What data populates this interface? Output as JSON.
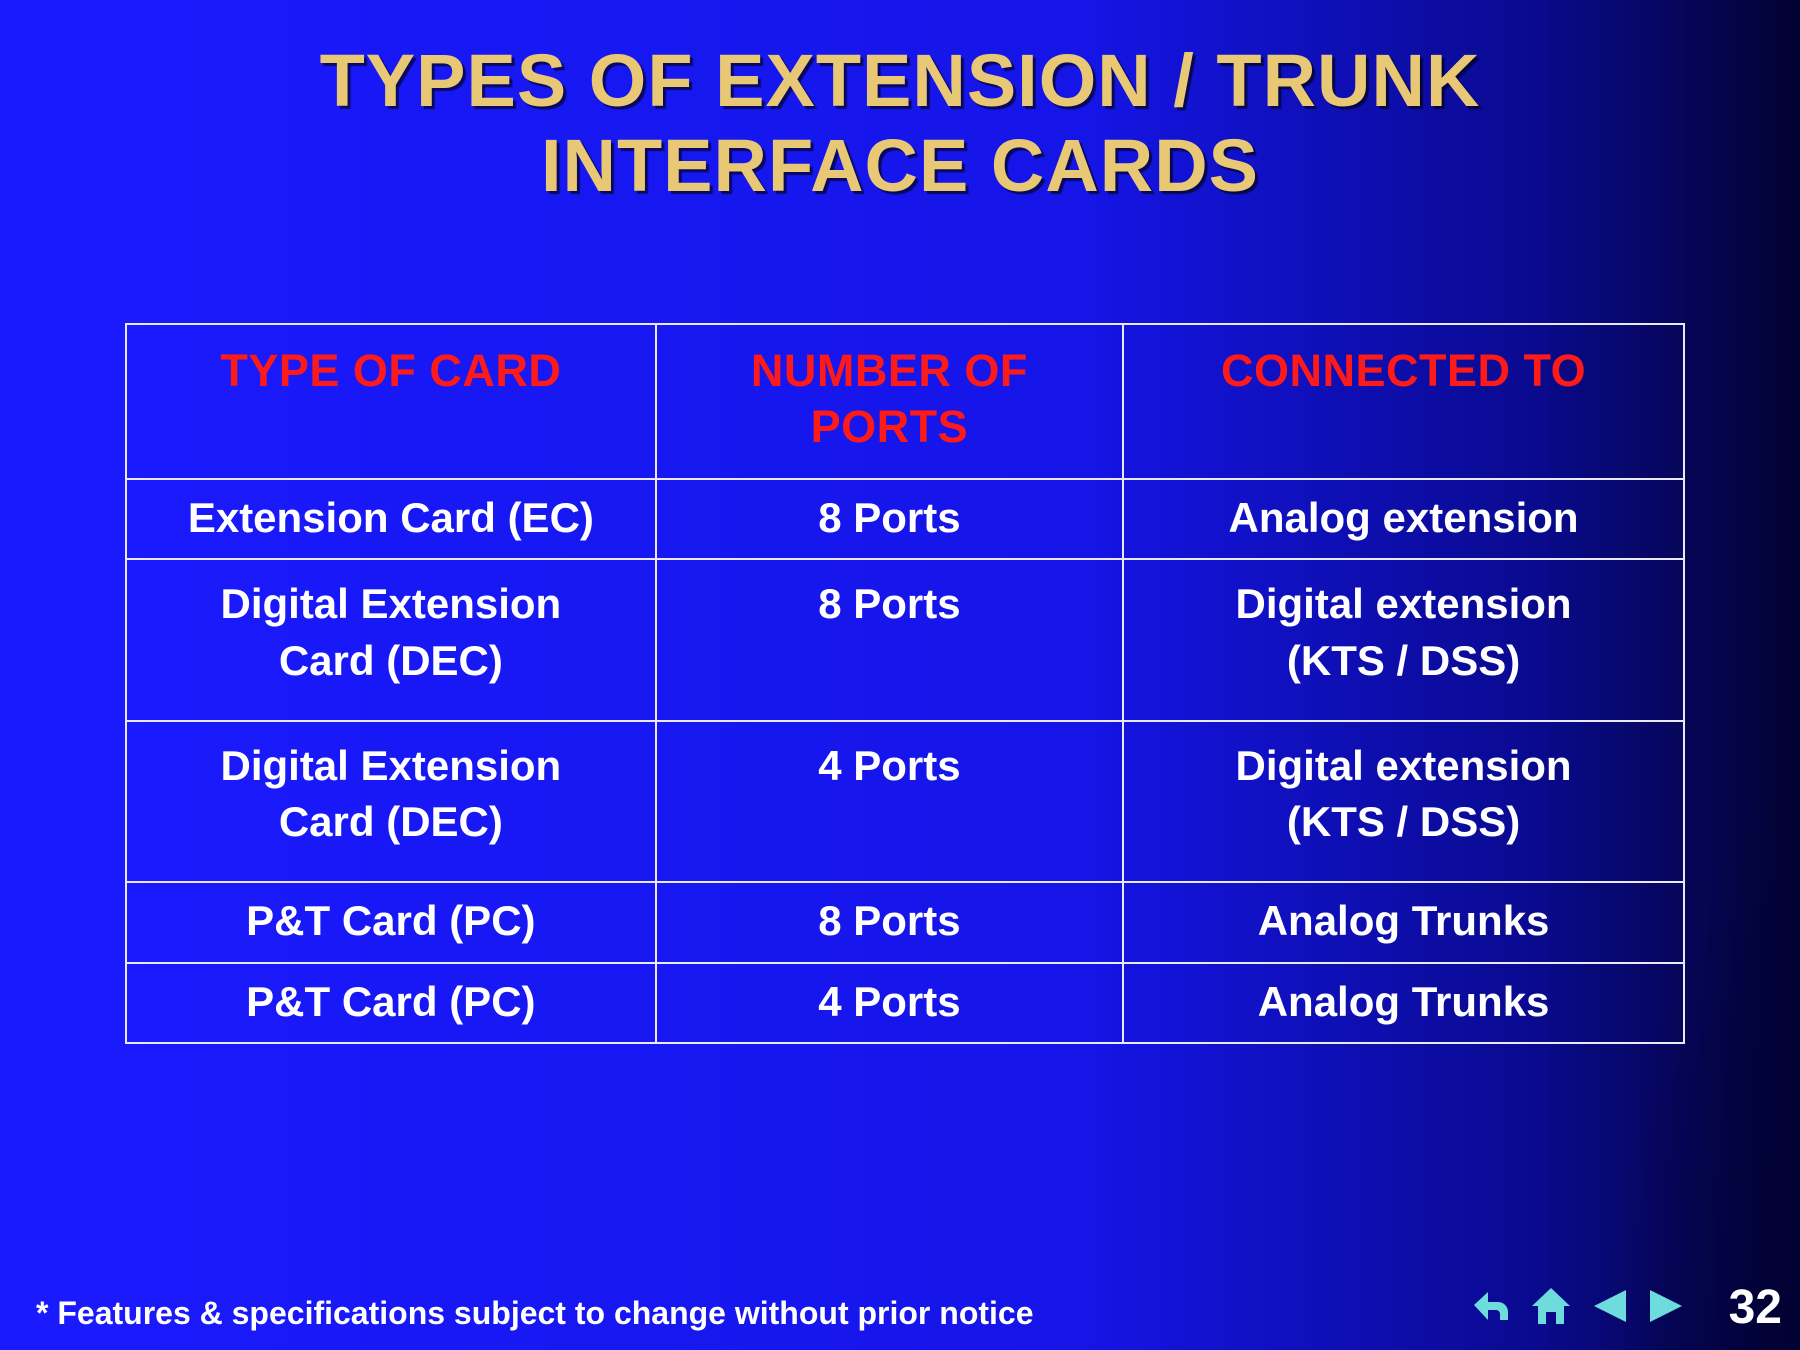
{
  "title": "TYPES OF EXTENSION / TRUNK\nINTERFACE CARDS",
  "table": {
    "headers": [
      "TYPE OF CARD",
      "NUMBER OF PORTS",
      "CONNECTED TO"
    ],
    "rows": [
      {
        "type": "Extension Card (EC)",
        "ports": "8 Ports",
        "connected": "Analog extension",
        "cls": "short"
      },
      {
        "type": "Digital Extension\nCard (DEC)",
        "ports": "8 Ports",
        "connected": "Digital extension\n(KTS / DSS)",
        "cls": "tall"
      },
      {
        "type": "Digital Extension\nCard (DEC)",
        "ports": "4 Ports",
        "connected": "Digital extension\n(KTS / DSS)",
        "cls": "tall"
      },
      {
        "type": "P&T Card (PC)",
        "ports": "8 Ports",
        "connected": "Analog Trunks",
        "cls": "short"
      },
      {
        "type": "P&T Card (PC)",
        "ports": "4 Ports",
        "connected": "Analog Trunks",
        "cls": "short"
      }
    ]
  },
  "footnote": "* Features & specifications subject to change without prior notice",
  "page_number": "32",
  "nav": {
    "return_icon": "return-icon",
    "home_icon": "home-icon",
    "prev_icon": "prev-icon",
    "next_icon": "next-icon",
    "color": "#6EDCDC"
  }
}
